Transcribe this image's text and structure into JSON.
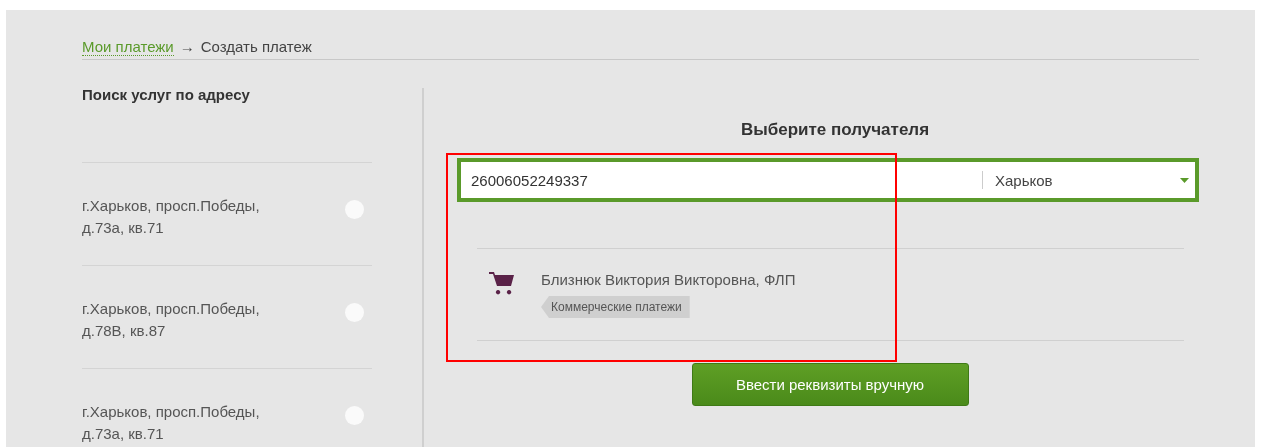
{
  "breadcrumb": {
    "link": "Мои платежи",
    "separator": "→",
    "current": "Создать платеж"
  },
  "address_search": {
    "title": "Поиск услуг по адресу",
    "addresses": [
      {
        "line_1": "г.Харьков, просп.Победы,",
        "line_2": "д.73а, кв.71",
        "selected": false
      },
      {
        "line_1": "г.Харьков, просп.Победы,",
        "line_2": "д.78В, кв.87",
        "selected": false
      },
      {
        "line_1": "г.Харьков, просп.Победы,",
        "line_2": "д.73а, кв.71",
        "selected": false
      }
    ]
  },
  "recipient": {
    "title": "Выберите получателя",
    "search_value": "26006052249337",
    "city": "Харьков",
    "results": [
      {
        "name": "Близнюк Виктория Викторовна, ФЛП",
        "tag": "Коммерческие платежи"
      }
    ],
    "manual_button": "Ввести реквизиты вручную"
  },
  "highlight": {
    "kind": "frame"
  }
}
